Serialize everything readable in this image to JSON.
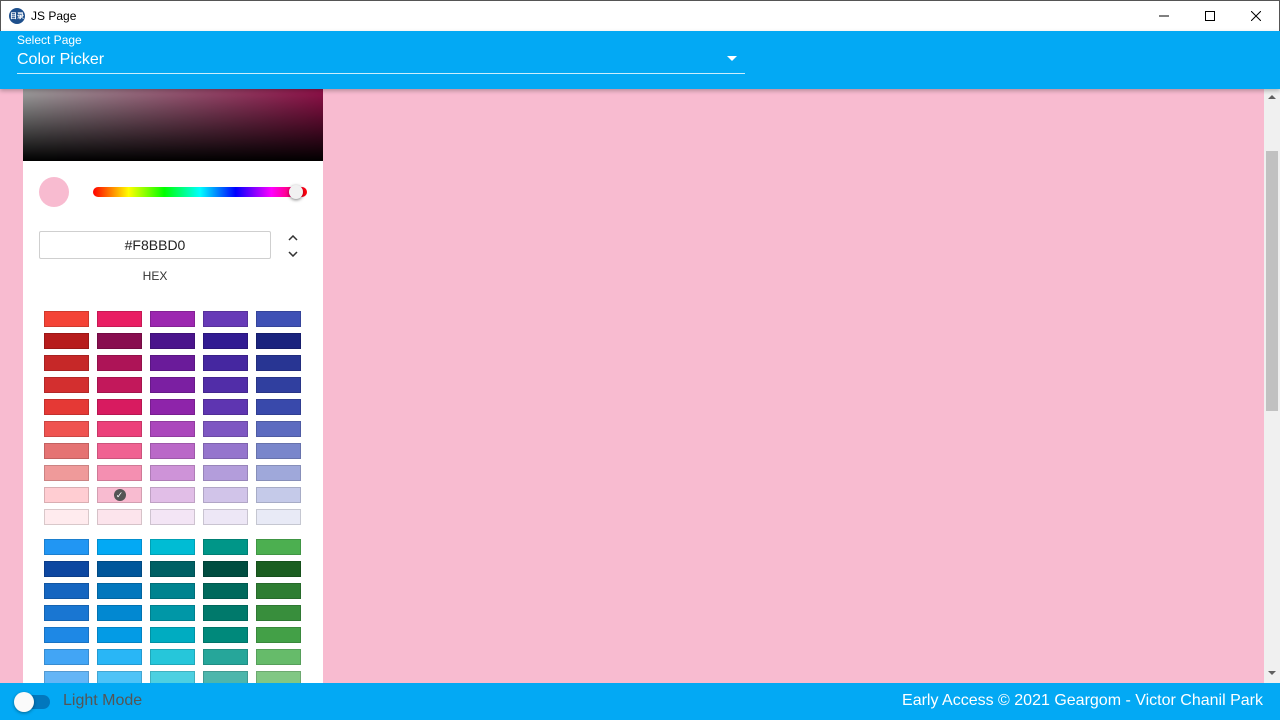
{
  "window": {
    "icon_text": "目录",
    "title": "JS Page"
  },
  "header": {
    "select_label": "Select Page",
    "select_value": "Color Picker"
  },
  "picker": {
    "current_color": "#f8bbd0",
    "hex_value": "#F8BBD0",
    "hex_label": "HEX",
    "selected_swatch": "#f8bbd0",
    "palette_groups": [
      [
        "#f44336",
        "#e91e63",
        "#9c27b0",
        "#673ab7",
        "#3f51b5",
        "#b71c1c",
        "#880e4f",
        "#4a148c",
        "#311b92",
        "#1a237e",
        "#c62828",
        "#ad1457",
        "#6a1b9a",
        "#4527a0",
        "#283593",
        "#d32f2f",
        "#c2185b",
        "#7b1fa2",
        "#512da8",
        "#303f9f",
        "#e53935",
        "#d81b60",
        "#8e24aa",
        "#5e35b1",
        "#3949ab",
        "#ef5350",
        "#ec407a",
        "#ab47bc",
        "#7e57c2",
        "#5c6bc0",
        "#e57373",
        "#f06292",
        "#ba68c8",
        "#9575cd",
        "#7986cb",
        "#ef9a9a",
        "#f48fb1",
        "#ce93d8",
        "#b39ddb",
        "#9fa8da",
        "#ffcdd2",
        "#f8bbd0",
        "#e1bee7",
        "#d1c4e9",
        "#c5cae9",
        "#ffebee",
        "#fce4ec",
        "#f3e5f5",
        "#ede7f6",
        "#e8eaf6"
      ],
      [
        "#2196f3",
        "#03a9f4",
        "#00bcd4",
        "#009688",
        "#4caf50",
        "#0d47a1",
        "#01579b",
        "#006064",
        "#004d40",
        "#1b5e20",
        "#1565c0",
        "#0277bd",
        "#00838f",
        "#00695c",
        "#2e7d32",
        "#1976d2",
        "#0288d1",
        "#0097a7",
        "#00796b",
        "#388e3c",
        "#1e88e5",
        "#039be5",
        "#00acc1",
        "#00897b",
        "#43a047",
        "#42a5f5",
        "#29b6f6",
        "#26c6da",
        "#26a69a",
        "#66bb6a",
        "#64b5f6",
        "#4fc3f7",
        "#4dd0e1",
        "#4db6ac",
        "#81c784"
      ]
    ]
  },
  "footer": {
    "mode_label": "Light Mode",
    "copyright": "Early Access © 2021 Geargom - Victor Chanil Park"
  },
  "icons": {
    "minimize": "minimize-icon",
    "maximize": "maximize-icon",
    "close": "close-icon",
    "dropdown": "chevron-down-icon",
    "selected": "check-icon"
  }
}
